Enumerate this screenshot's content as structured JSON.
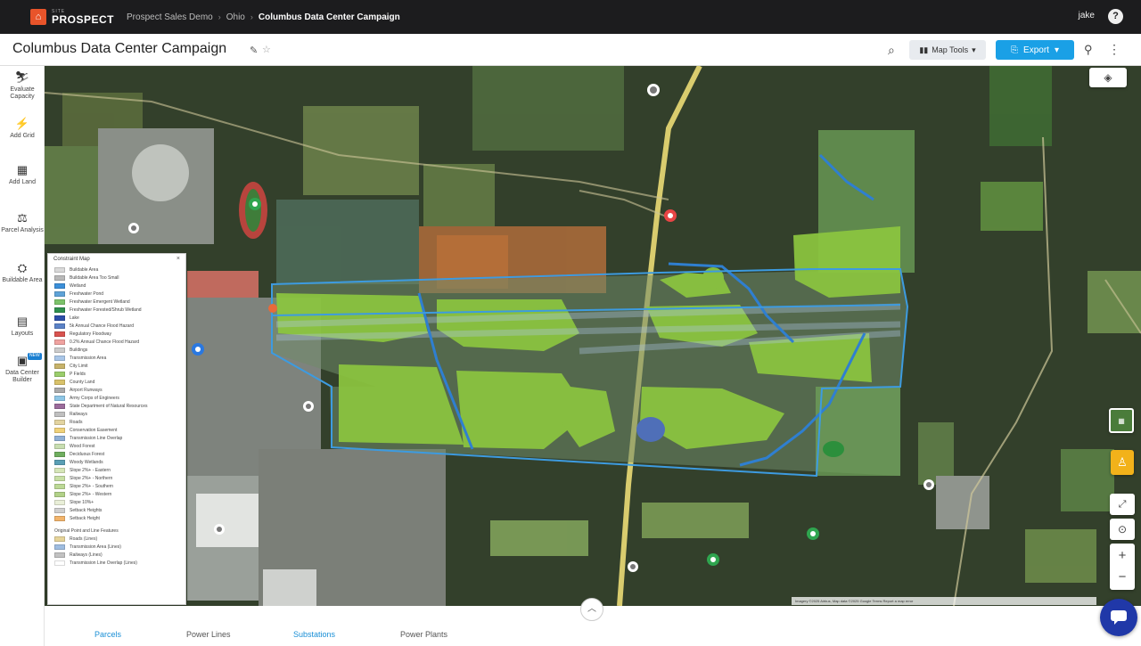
{
  "topnav": {
    "brand_small": "SITE",
    "brand": "PROSPECT",
    "crumbs": [
      "Prospect Sales Demo",
      "Ohio",
      "Columbus Data Center Campaign"
    ],
    "user": "jake",
    "help": "?"
  },
  "header": {
    "title": "Columbus Data Center Campaign",
    "map_tools": "Map Tools",
    "export": "Export"
  },
  "rail": [
    {
      "icon": "evaluate-capacity-icon",
      "glyph": "⛷",
      "label": "Evaluate Capacity"
    },
    {
      "icon": "add-grid-icon",
      "glyph": "⚡",
      "label": "Add Grid"
    },
    {
      "icon": "add-land-icon",
      "glyph": "▦",
      "label": "Add Land"
    },
    {
      "icon": "parcel-analysis-icon",
      "glyph": "⚖",
      "label": "Parcel Analysis"
    },
    {
      "icon": "buildable-area-icon",
      "glyph": "⛭",
      "label": "Buildable Area"
    },
    {
      "icon": "layouts-icon",
      "glyph": "▤",
      "label": "Layouts"
    },
    {
      "icon": "data-center-builder-icon",
      "glyph": "▣",
      "label": "Data Center Builder",
      "badge": "NEW"
    }
  ],
  "legend": {
    "title": "Constraint Map",
    "rows": [
      {
        "label": "Buildable Area",
        "color": "#d9d9d9"
      },
      {
        "label": "Buildable Area Too Small",
        "color": "#b8b8b8"
      },
      {
        "label": "Wetland",
        "color": "#3b8fd9"
      },
      {
        "label": "Freshwater Pond",
        "color": "#5fa3d8"
      },
      {
        "label": "Freshwater Emergent Wetland",
        "color": "#7cc36a"
      },
      {
        "label": "Freshwater Forested/Shrub Wetland",
        "color": "#2f8f4e"
      },
      {
        "label": "Lake",
        "color": "#2c4ea8"
      },
      {
        "label": "5k Annual Chance Flood Hazard",
        "color": "#5b82c7"
      },
      {
        "label": "Regulatory Floodway",
        "color": "#d9534f"
      },
      {
        "label": "0.2% Annual Chance Flood Hazard",
        "color": "#f0a3a0"
      },
      {
        "label": "Buildings",
        "color": "#cccccc"
      },
      {
        "label": "Transmission Area",
        "color": "#a9c6e8"
      },
      {
        "label": "City Limit",
        "color": "#c7b36a"
      },
      {
        "label": "P Fields",
        "color": "#9acd6b"
      },
      {
        "label": "County Land",
        "color": "#d9c26a"
      },
      {
        "label": "Airport Runways",
        "color": "#aaaaaa"
      },
      {
        "label": "Army Corps of Engineers",
        "color": "#8ec6e6"
      },
      {
        "label": "State Department of Natural Resources",
        "color": "#9b6b9b"
      },
      {
        "label": "Railways",
        "color": "#bfbfbf"
      },
      {
        "label": "Roads",
        "color": "#e3d4a0"
      },
      {
        "label": "Conservation Easement",
        "color": "#f0d27a"
      },
      {
        "label": "Transmission Line Overlap",
        "color": "#8fb0d6"
      },
      {
        "label": "Wood Forest",
        "color": "#c8deb1"
      },
      {
        "label": "Deciduous Forest",
        "color": "#6fae5f"
      },
      {
        "label": "Woody Wetlands",
        "color": "#5a9fb5"
      },
      {
        "label": "Slope 2%+ - Eastern",
        "color": "#d6e6b8"
      },
      {
        "label": "Slope 2%+ - Northern",
        "color": "#c7dfa4"
      },
      {
        "label": "Slope 2%+ - Southern",
        "color": "#bcd996"
      },
      {
        "label": "Slope 2%+ - Western",
        "color": "#b1d188"
      },
      {
        "label": "Slope 10%+",
        "color": "#e9efd8"
      },
      {
        "label": "Setback Heights",
        "color": "#cfcfcf"
      },
      {
        "label": "Setback Height",
        "color": "#f2b46b"
      }
    ],
    "section2_title": "Original Point and Line Features",
    "rows2": [
      {
        "label": "Roads (Lines)",
        "color": "#e6d49a"
      },
      {
        "label": "Transmission Area (Lines)",
        "color": "#9fbde0"
      },
      {
        "label": "Railways (Lines)",
        "color": "#c2c2c2"
      },
      {
        "label": "Transmission Line Overlap (Lines)",
        "color": "#ffffff"
      }
    ]
  },
  "map": {
    "zoom_in": "+",
    "zoom_out": "−",
    "attribution": "Imagery ©2025 Airbus, Map data ©2025 Google  Terms  Report a map error"
  },
  "tabs": [
    {
      "label": "Parcels",
      "active": true
    },
    {
      "label": "Power Lines",
      "active": false
    },
    {
      "label": "Substations",
      "active": true
    },
    {
      "label": "Power Plants",
      "active": false
    }
  ]
}
